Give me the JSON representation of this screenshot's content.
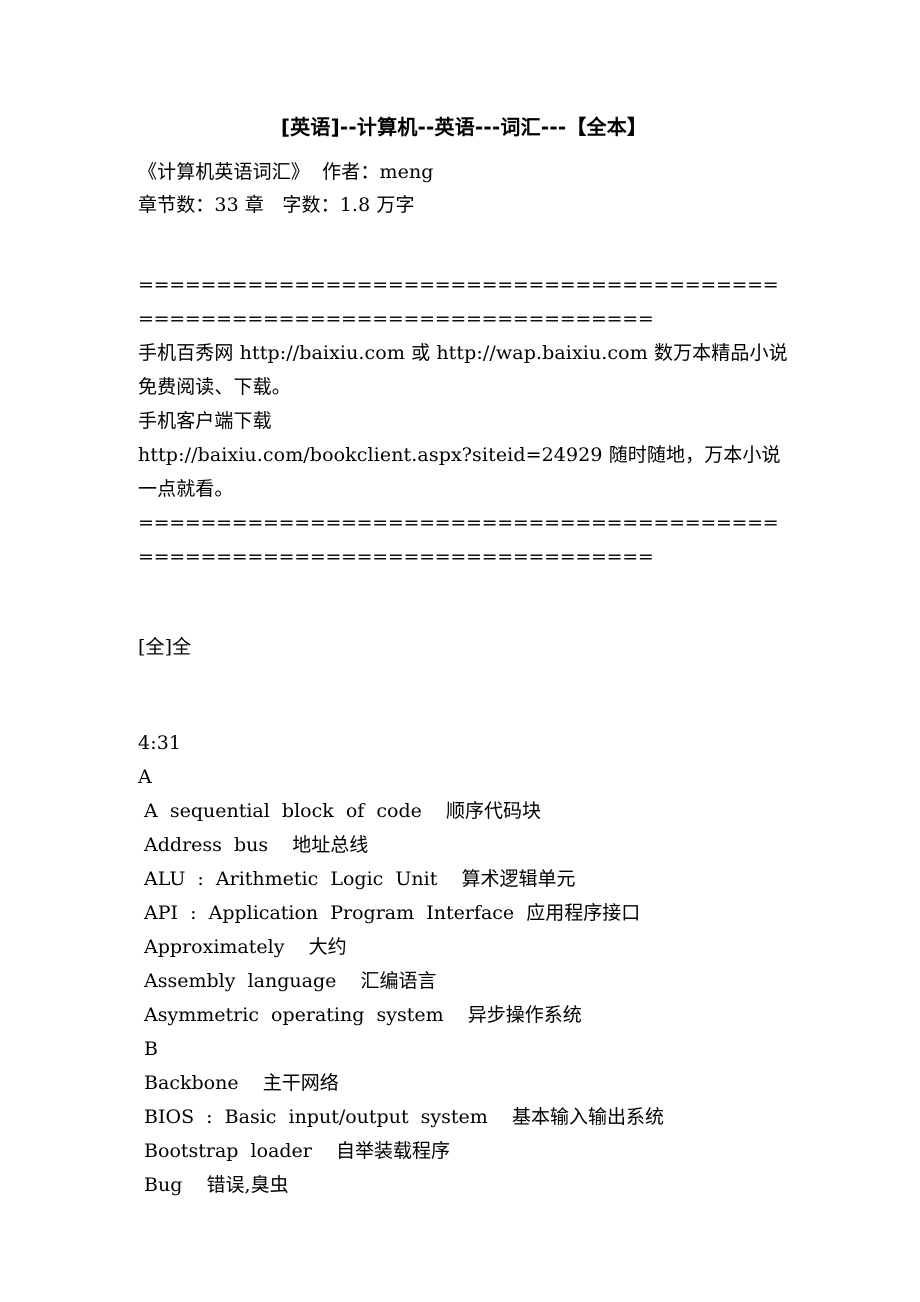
{
  "document": {
    "title": "[英语]--计算机--英语---词汇---【全本】",
    "book_info": "《计算机英语词汇》  作者：meng",
    "chapter_info": "章节数：33 章   字数：1.8 万字",
    "separator_top": "==========================================================================",
    "promo_line_1": "手机百秀网 http://baixiu.com 或 http://wap.baixiu.com 数万本精品小说免费阅读、下载。",
    "promo_line_2": "手机客户端下载",
    "promo_line_3": "http://baixiu.com/bookclient.aspx?siteid=24929 随时随地，万本小说一点就看。",
    "separator_bottom": "==========================================================================",
    "volume_marker": "[全]全",
    "timestamp": "4:31"
  },
  "glossary": {
    "sections": [
      {
        "letter": "A",
        "entries": [
          " A  sequential  block  of  code    顺序代码块",
          " Address  bus    地址总线",
          " ALU  :  Arithmetic  Logic  Unit    算术逻辑单元",
          " API  :  Application  Program  Interface  应用程序接口",
          " Approximately    大约",
          " Assembly  language    汇编语言",
          " Asymmetric  operating  system    异步操作系统"
        ]
      },
      {
        "letter": " B",
        "entries": [
          " Backbone    主干网络",
          " BIOS  :  Basic  input/output  system    基本输入输出系统",
          " Bootstrap  loader    自举装载程序",
          " Bug    错误,臭虫"
        ]
      }
    ]
  }
}
